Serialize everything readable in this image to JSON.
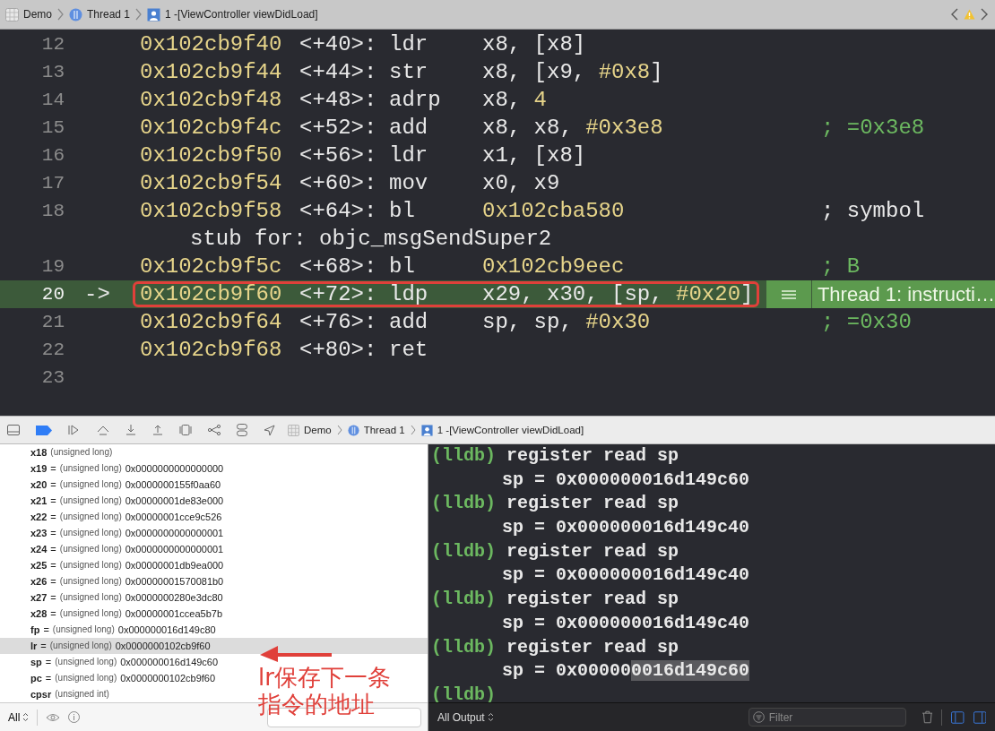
{
  "breadcrumb": [
    {
      "label": "Demo",
      "kind": "project"
    },
    {
      "label": "Thread 1",
      "kind": "thread"
    },
    {
      "label": "1 -[ViewController viewDidLoad]",
      "kind": "frame"
    }
  ],
  "code": {
    "lines": [
      {
        "number": "12",
        "current": false,
        "address": "0x102cb9f40",
        "offset": "<+40>:",
        "mnemonic": "ldr",
        "operands": [
          {
            "text": "x8, [x8]",
            "kind": "plain"
          }
        ]
      },
      {
        "number": "13",
        "current": false,
        "address": "0x102cb9f44",
        "offset": "<+44>:",
        "mnemonic": "str",
        "operands": [
          {
            "text": "x8, [x9, ",
            "kind": "plain"
          },
          {
            "text": "#0x8",
            "kind": "number"
          },
          {
            "text": "]",
            "kind": "plain"
          }
        ]
      },
      {
        "number": "14",
        "current": false,
        "address": "0x102cb9f48",
        "offset": "<+48>:",
        "mnemonic": "adrp",
        "operands": [
          {
            "text": "x8, ",
            "kind": "plain"
          },
          {
            "text": "4",
            "kind": "number"
          }
        ]
      },
      {
        "number": "15",
        "current": false,
        "address": "0x102cb9f4c",
        "offset": "<+52>:",
        "mnemonic": "add",
        "operands": [
          {
            "text": "x8, x8, ",
            "kind": "plain"
          },
          {
            "text": "#0x3e8",
            "kind": "number"
          }
        ],
        "comment": "; =0x3e8"
      },
      {
        "number": "16",
        "current": false,
        "address": "0x102cb9f50",
        "offset": "<+56>:",
        "mnemonic": "ldr",
        "operands": [
          {
            "text": "x1, [x8]",
            "kind": "plain"
          }
        ]
      },
      {
        "number": "17",
        "current": false,
        "address": "0x102cb9f54",
        "offset": "<+60>:",
        "mnemonic": "mov",
        "operands": [
          {
            "text": "x0, x9",
            "kind": "plain"
          }
        ]
      },
      {
        "number": "18",
        "current": false,
        "address": "0x102cb9f58",
        "offset": "<+64>:",
        "mnemonic": "bl",
        "operands": [
          {
            "text": "0x102cba580",
            "kind": "number"
          }
        ],
        "comment": "; symbol",
        "continuation": "stub for: objc_msgSendSuper2"
      },
      {
        "number": "19",
        "current": false,
        "address": "0x102cb9f5c",
        "offset": "<+68>:",
        "mnemonic": "bl",
        "operands": [
          {
            "text": "0x102cb9eec",
            "kind": "number"
          }
        ],
        "comment": "; B"
      },
      {
        "number": "20",
        "current": true,
        "arrow": "->",
        "address": "0x102cb9f60",
        "offset": "<+72>:",
        "mnemonic": "ldp",
        "operands": [
          {
            "text": "x29, x30, [sp, ",
            "kind": "plain"
          },
          {
            "text": "#0x20",
            "kind": "number"
          },
          {
            "text": "]",
            "kind": "plain"
          }
        ],
        "badge": "Thread 1: instructi…"
      },
      {
        "number": "21",
        "current": false,
        "address": "0x102cb9f64",
        "offset": "<+76>:",
        "mnemonic": "add",
        "operands": [
          {
            "text": "sp, sp, ",
            "kind": "plain"
          },
          {
            "text": "#0x30",
            "kind": "number"
          }
        ],
        "comment": "; =0x30"
      },
      {
        "number": "22",
        "current": false,
        "address": "0x102cb9f68",
        "offset": "<+80>:",
        "mnemonic": "ret"
      },
      {
        "number": "23",
        "current": false
      }
    ]
  },
  "debug_bar": {
    "breadcrumb": [
      {
        "label": "Demo",
        "kind": "project"
      },
      {
        "label": "Thread 1",
        "kind": "thread"
      },
      {
        "label": "1 -[ViewController viewDidLoad]",
        "kind": "frame"
      }
    ]
  },
  "variables": {
    "rows": [
      {
        "name": "x18",
        "type": "(unsigned long)",
        "selected": false
      },
      {
        "name": "x19",
        "sign": "=",
        "type": "(unsigned long)",
        "value": "0x0000000000000000",
        "selected": false
      },
      {
        "name": "x20",
        "sign": "=",
        "type": "(unsigned long)",
        "value": "0x0000000155f0aa60",
        "selected": false
      },
      {
        "name": "x21",
        "sign": "=",
        "type": "(unsigned long)",
        "value": "0x00000001de83e000",
        "selected": false
      },
      {
        "name": "x22",
        "sign": "=",
        "type": "(unsigned long)",
        "value": "0x00000001cce9c526",
        "selected": false
      },
      {
        "name": "x23",
        "sign": "=",
        "type": "(unsigned long)",
        "value": "0x0000000000000001",
        "selected": false
      },
      {
        "name": "x24",
        "sign": "=",
        "type": "(unsigned long)",
        "value": "0x0000000000000001",
        "selected": false
      },
      {
        "name": "x25",
        "sign": "=",
        "type": "(unsigned long)",
        "value": "0x00000001db9ea000",
        "selected": false
      },
      {
        "name": "x26",
        "sign": "=",
        "type": "(unsigned long)",
        "value": "0x00000001570081b0",
        "selected": false
      },
      {
        "name": "x27",
        "sign": "=",
        "type": "(unsigned long)",
        "value": "0x0000000280e3dc80",
        "selected": false
      },
      {
        "name": "x28",
        "sign": "=",
        "type": "(unsigned long)",
        "value": "0x00000001ccea5b7b",
        "selected": false
      },
      {
        "name": "fp",
        "sign": "=",
        "type": "(unsigned long)",
        "value": "0x000000016d149c80",
        "selected": false
      },
      {
        "name": "lr",
        "sign": "=",
        "type": "(unsigned long)",
        "value": "0x0000000102cb9f60",
        "selected": true
      },
      {
        "name": "sp",
        "sign": "=",
        "type": "(unsigned long)",
        "value": "0x000000016d149c60",
        "selected": false
      },
      {
        "name": "pc",
        "sign": "=",
        "type": "(unsigned long)",
        "value": "0x0000000102cb9f60",
        "selected": false
      },
      {
        "name": "cpsr",
        "type": "(unsigned int)",
        "selected": false
      }
    ],
    "scope": "All"
  },
  "annotation": {
    "lines": [
      "lr保存下一条",
      "指令的地址"
    ]
  },
  "console": {
    "entries": [
      {
        "prompt": "(lldb)",
        "command": "register read sp",
        "result": "sp = 0x000000016d149c60"
      },
      {
        "prompt": "(lldb)",
        "command": "register read sp",
        "result": "sp = 0x000000016d149c40"
      },
      {
        "prompt": "(lldb)",
        "command": "register read sp",
        "result": "sp = 0x000000016d149c40"
      },
      {
        "prompt": "(lldb)",
        "command": "register read sp",
        "result": "sp = 0x000000016d149c40"
      },
      {
        "prompt": "(lldb)",
        "command": "register read sp",
        "result": "sp = 0x00000",
        "selected_text": "0016d149c60"
      }
    ],
    "prompt": "(lldb)",
    "output_scope": "All Output",
    "filter_placeholder": "Filter"
  }
}
